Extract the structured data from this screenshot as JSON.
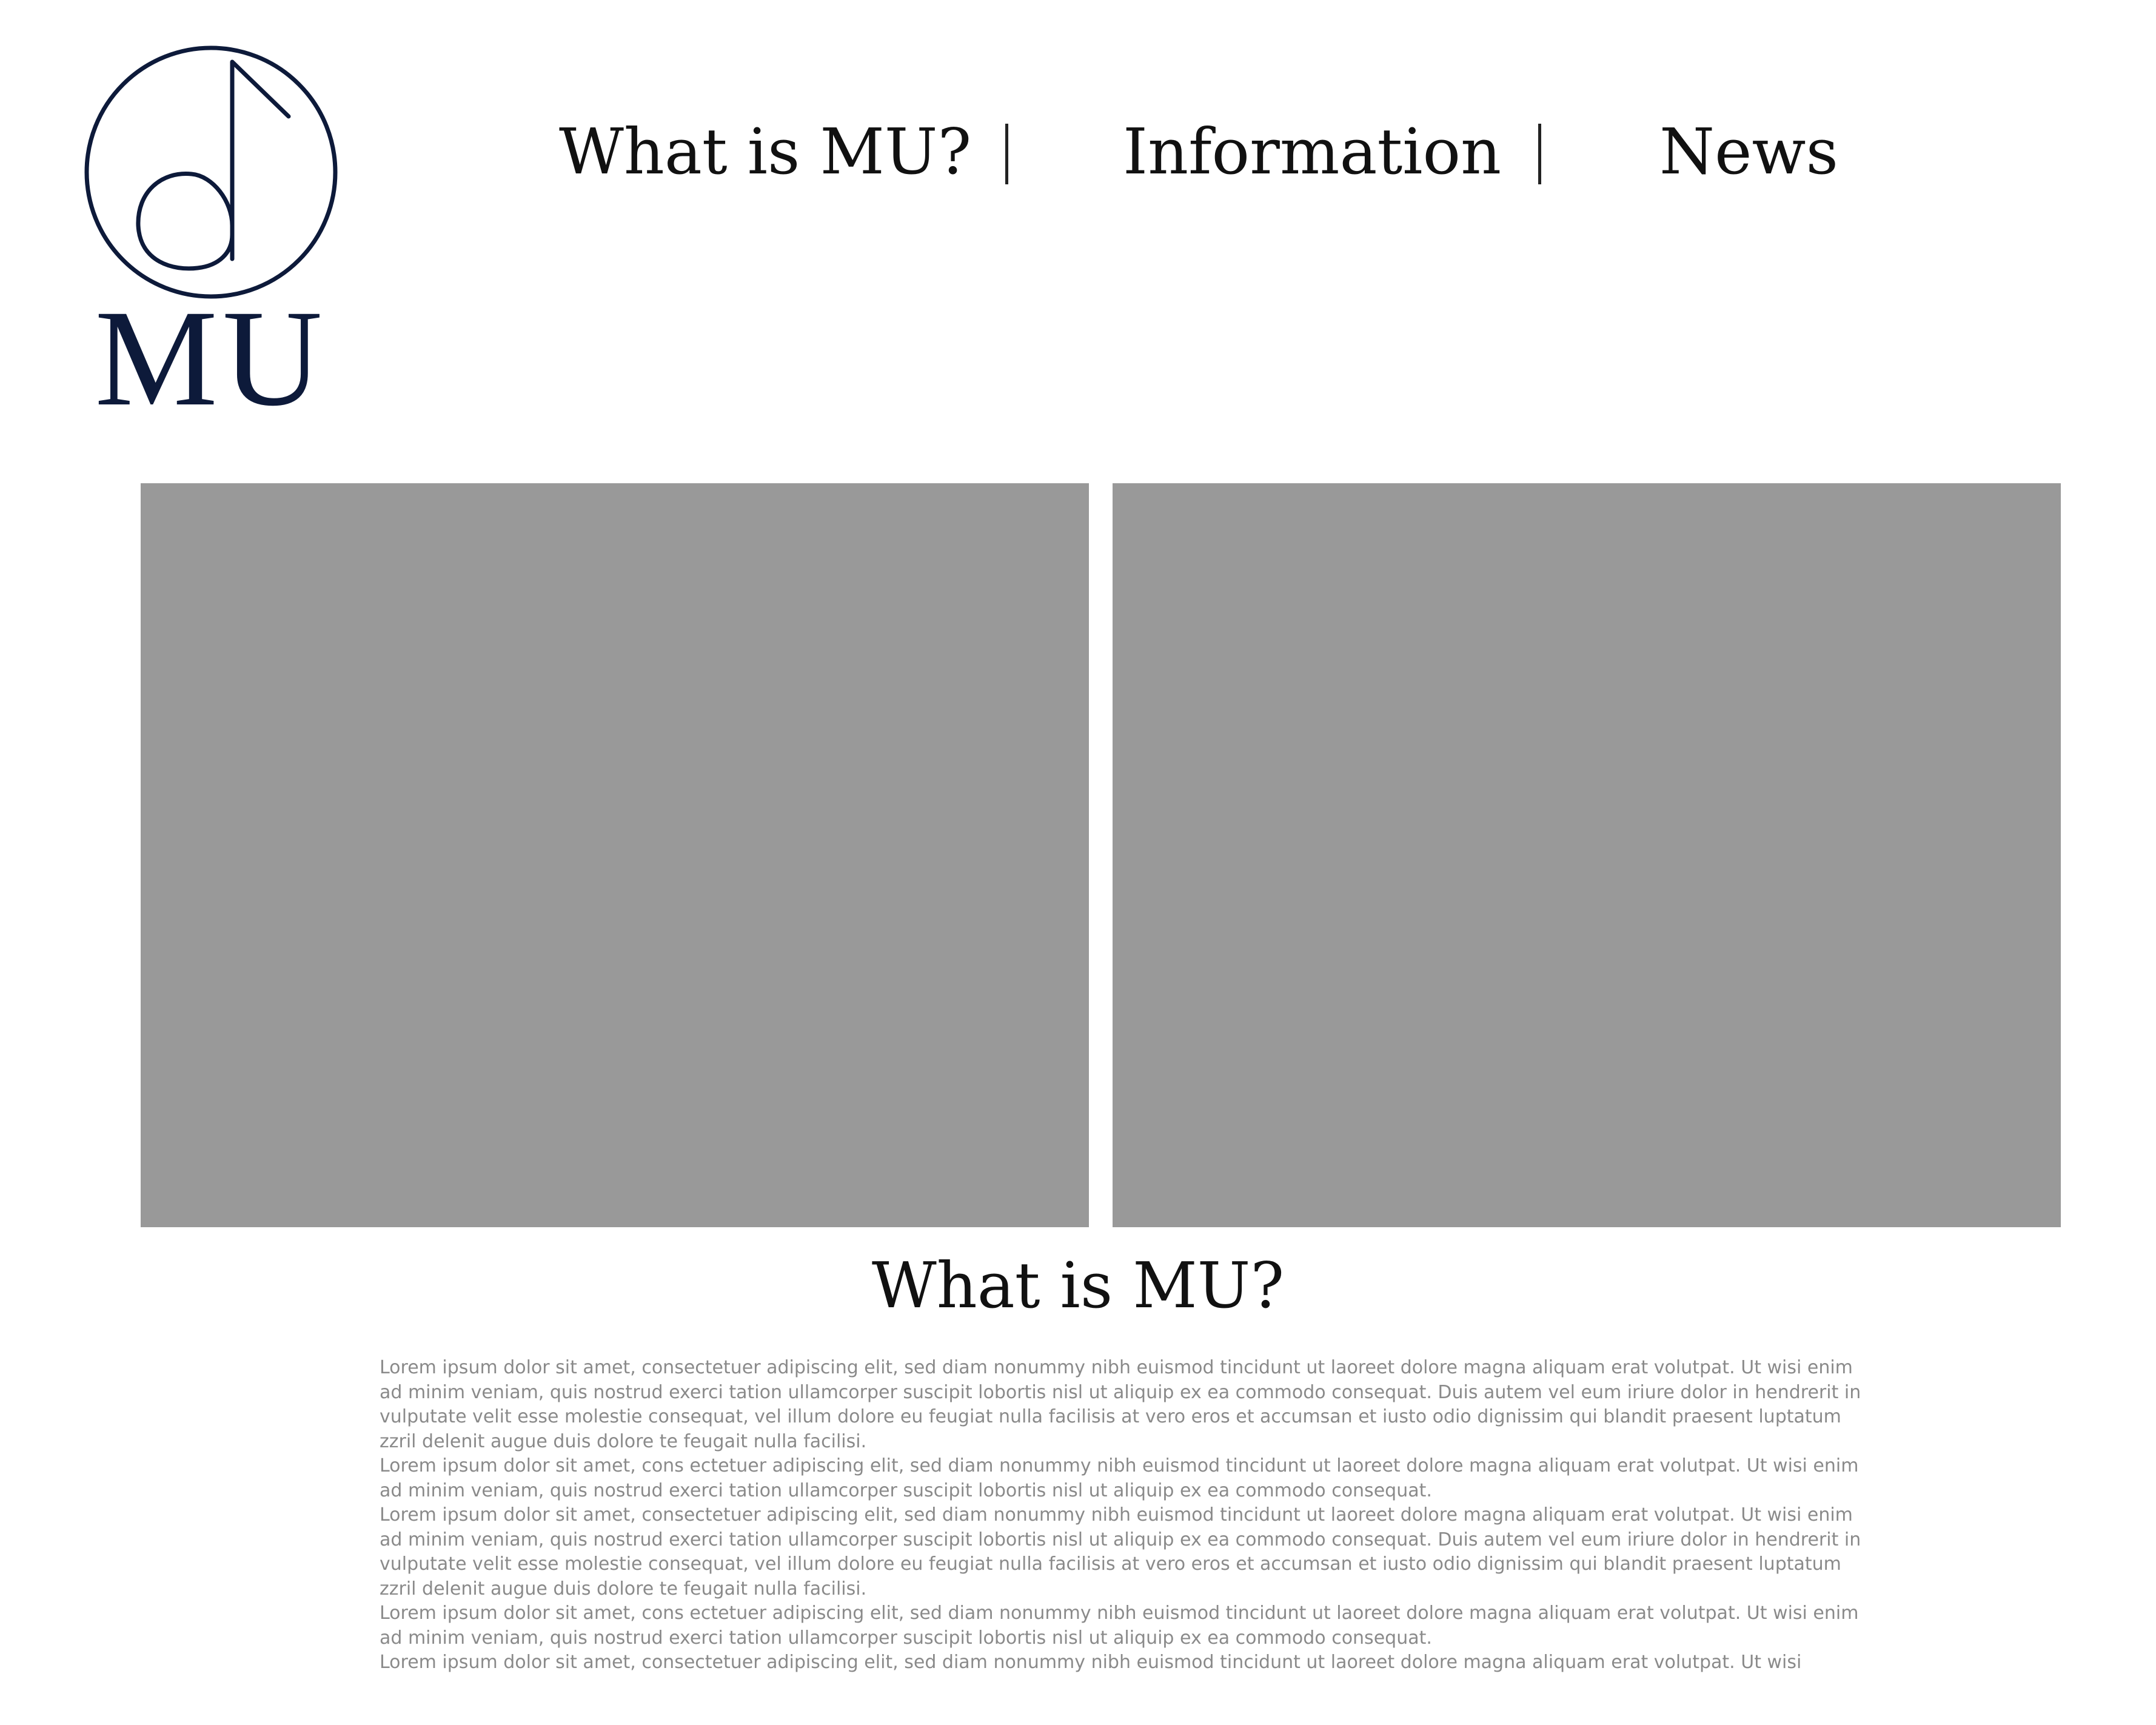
{
  "logo": {
    "text": "MU",
    "icon": "music-note-circle-icon",
    "color": "#0d1a3a"
  },
  "nav": {
    "items": [
      {
        "label": "What is MU?"
      },
      {
        "label": "Information"
      },
      {
        "label": "News"
      }
    ],
    "separator": "|"
  },
  "images": [
    {
      "label": "placeholder-image",
      "color": "#999999"
    },
    {
      "label": "placeholder-image",
      "color": "#999999"
    }
  ],
  "section": {
    "title": "What is MU?",
    "paragraphs": [
      "Lorem ipsum dolor sit amet, consectetuer adipiscing elit, sed diam nonummy nibh euismod tincidunt ut laoreet dolore magna aliquam erat volutpat. Ut wisi enim ad minim veniam, quis nostrud exerci tation ullamcorper suscipit lobortis nisl ut aliquip ex ea commodo consequat. Duis autem vel eum iriure dolor in hendrerit in vulputate velit esse molestie consequat, vel illum dolore eu feugiat nulla facilisis at vero eros et accumsan et iusto odio dignissim qui blandit praesent luptatum zzril delenit augue duis dolore te feugait nulla facilisi.",
      "Lorem ipsum dolor sit amet, cons ectetuer adipiscing elit, sed diam nonummy nibh euismod tincidunt ut laoreet dolore magna aliquam erat volutpat. Ut wisi enim ad minim veniam, quis nostrud exerci tation ullamcorper suscipit lobortis nisl ut aliquip ex ea commodo consequat.",
      "Lorem ipsum dolor sit amet, consectetuer adipiscing elit, sed diam nonummy nibh euismod tincidunt ut laoreet dolore magna aliquam erat volutpat. Ut wisi enim ad minim veniam, quis nostrud exerci tation ullamcorper suscipit lobortis nisl ut aliquip ex ea commodo consequat. Duis autem vel eum iriure dolor in hendrerit in vulputate velit esse molestie consequat, vel illum dolore eu feugiat nulla facilisis at vero eros et accumsan et iusto odio dignissim qui blandit praesent luptatum zzril delenit augue duis dolore te feugait nulla facilisi.",
      "Lorem ipsum dolor sit amet, cons ectetuer adipiscing elit, sed diam nonummy nibh euismod tincidunt ut laoreet dolore magna aliquam erat volutpat. Ut wisi enim ad minim veniam, quis nostrud exerci tation ullamcorper suscipit lobortis nisl ut aliquip ex ea commodo consequat.",
      "Lorem ipsum dolor sit amet, consectetuer adipiscing elit, sed diam nonummy nibh euismod tincidunt ut laoreet dolore magna aliquam erat volutpat. Ut wisi"
    ]
  }
}
